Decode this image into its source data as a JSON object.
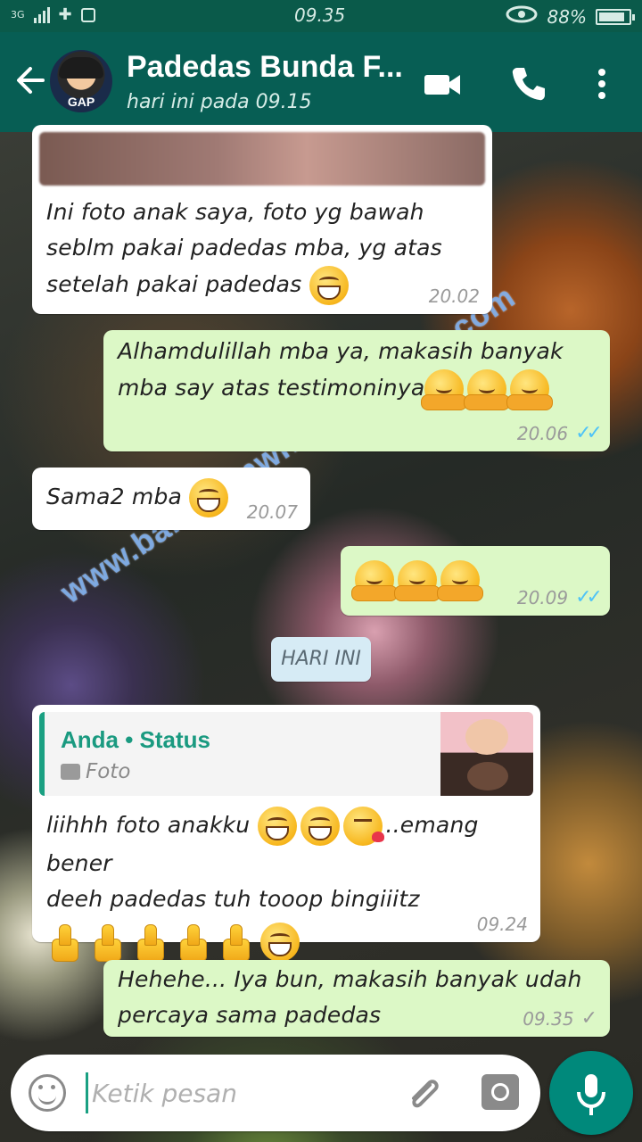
{
  "status_bar": {
    "network": "3G",
    "time": "09.35",
    "battery": "88%",
    "battery_level": 0.88
  },
  "header": {
    "title": "Padedas Bunda F...",
    "subtitle": "hari ini pada 09.15",
    "avatar_text": "GAP"
  },
  "watermark": "www.babyskinwhiteningnare.com",
  "messages": [
    {
      "direction": "in",
      "text_lines": [
        "Ini foto anak saya, foto yg bawah",
        "seblm pakai padedas mba, yg atas",
        "setelah pakai padedas"
      ],
      "emojis": [
        "grin"
      ],
      "time": "20.02"
    },
    {
      "direction": "out",
      "text_lines": [
        "Alhamdulillah mba ya, makasih banyak",
        "mba say atas testimoninya"
      ],
      "emojis": [
        "hug",
        "hug",
        "hug"
      ],
      "time": "20.06",
      "status": "read"
    },
    {
      "direction": "in",
      "text_lines": [
        "Sama2 mba"
      ],
      "emojis": [
        "grin"
      ],
      "time": "20.07"
    },
    {
      "direction": "out",
      "text_lines": [],
      "emojis": [
        "hug",
        "hug",
        "hug"
      ],
      "time": "20.09",
      "status": "read"
    },
    {
      "direction": "in",
      "quote": {
        "name": "Anda • Status",
        "type": "Foto"
      },
      "text_lines": [
        "liihhh foto anakku",
        "..emang bener",
        "deeh padedas tuh tooop bingiiitz"
      ],
      "time": "09.24"
    },
    {
      "direction": "out",
      "text_lines": [
        "Hehehe... Iya bun, makasih banyak udah",
        "percaya sama padedas"
      ],
      "time": "09.35",
      "status": "sent"
    }
  ],
  "date_chip": "HARI INI",
  "input": {
    "placeholder": "Ketik pesan"
  },
  "colors": {
    "header": "#075e54",
    "status_bar": "#0a5a4a",
    "outgoing_bubble": "#dcf8c6",
    "incoming_bubble": "#ffffff",
    "read_ticks": "#4fc3f7",
    "mic_button": "#00897b"
  }
}
